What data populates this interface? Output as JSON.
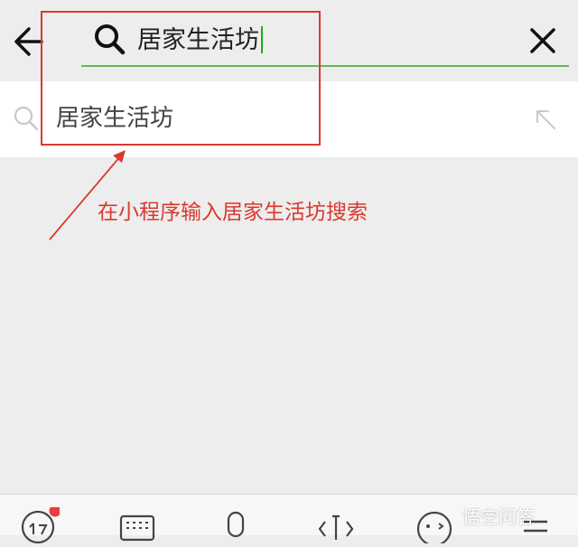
{
  "search": {
    "query": "居家生活坊"
  },
  "suggestions": [
    {
      "label": "居家生活坊"
    }
  ],
  "annotation": {
    "text": "在小程序输入居家生活坊搜索",
    "color": "#d93a2e"
  },
  "keyboard_toolbar": {
    "items": [
      "handwriting-icon",
      "keyboard-icon",
      "microphone-icon",
      "cursor-icon",
      "emoji-icon",
      "menu-icon"
    ],
    "badge_color": "#ee3b3b"
  },
  "watermark": {
    "text": "悟空问答"
  },
  "colors": {
    "accent_green": "#1aad19",
    "background": "#ededed"
  }
}
